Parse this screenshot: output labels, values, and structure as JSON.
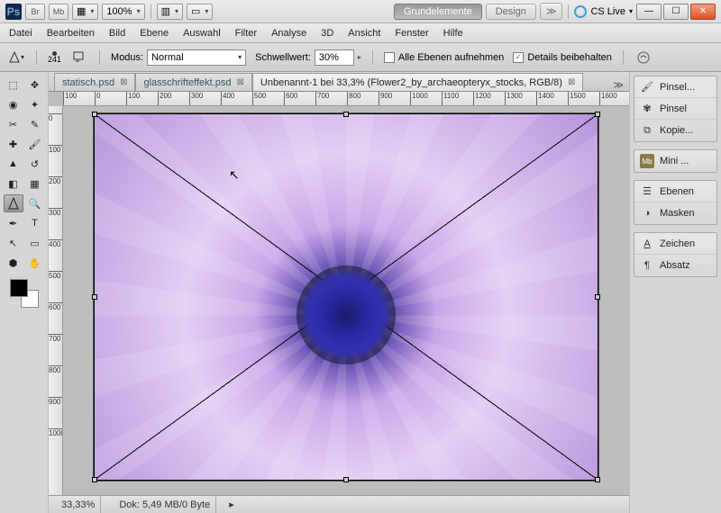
{
  "titlebar": {
    "app": "Ps",
    "br": "Br",
    "mb": "Mb",
    "zoom": "100%",
    "grundelemente": "Grundelemente",
    "design": "Design",
    "cslive": "CS Live"
  },
  "menu": {
    "items": [
      "Datei",
      "Bearbeiten",
      "Bild",
      "Ebene",
      "Auswahl",
      "Filter",
      "Analyse",
      "3D",
      "Ansicht",
      "Fenster",
      "Hilfe"
    ]
  },
  "options": {
    "brush_size": "241",
    "modus_label": "Modus:",
    "modus_value": "Normal",
    "schwellwert_label": "Schwellwert:",
    "schwellwert_value": "30%",
    "alle_label": "Alle Ebenen aufnehmen",
    "details_label": "Details beibehalten",
    "alle_checked": "",
    "details_checked": "✓"
  },
  "tabs": {
    "t1": "statisch.psd",
    "t2": "glasschrifteffekt.psd",
    "t3": "Unbenannt-1 bei 33,3% (Flower2_by_archaeopteryx_stocks, RGB/8)"
  },
  "ruler_h": [
    "100",
    "0",
    "100",
    "200",
    "300",
    "400",
    "500",
    "600",
    "700",
    "800",
    "900",
    "1000",
    "1100",
    "1200",
    "1300",
    "1400",
    "1500",
    "1600"
  ],
  "ruler_v": [
    "0",
    "100",
    "200",
    "300",
    "400",
    "500",
    "600",
    "700",
    "800",
    "900",
    "1000"
  ],
  "status": {
    "zoom": "33,33%",
    "dok": "Dok: 5,49 MB/0 Byte"
  },
  "panels": {
    "p1": [
      "Pinsel...",
      "Pinsel",
      "Kopie..."
    ],
    "p2": [
      "Mini ..."
    ],
    "p3": [
      "Ebenen",
      "Masken"
    ],
    "p4": [
      "Zeichen",
      "Absatz"
    ]
  }
}
